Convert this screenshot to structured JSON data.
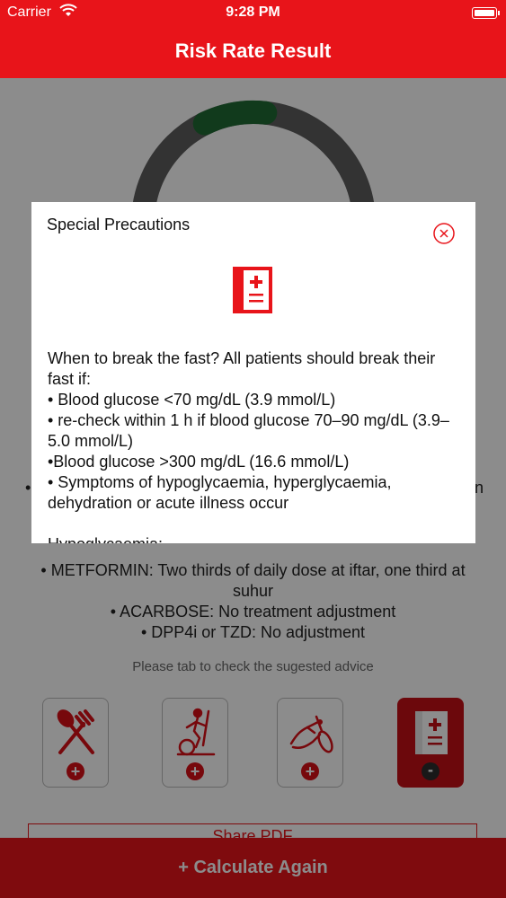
{
  "status_bar": {
    "carrier": "Carrier",
    "time": "9:28 PM"
  },
  "header": {
    "title": "Risk Rate Result"
  },
  "gauge": {
    "level": 0.3,
    "track_color": "#5e5e5e",
    "fill_color": "#1f6b33"
  },
  "content": {
    "bullet_fragment_left": "•",
    "bullet_fragment_right": "n",
    "treatment_lines": [
      "• METFORMIN: Two thirds of daily dose at iftar, one third at",
      "suhur",
      "• ACARBOSE: No treatment adjustment",
      "• DPP4i or TZD: No adjustment"
    ],
    "hint": "Please tab to check the sugested advice"
  },
  "advice_buttons": [
    {
      "name": "diet",
      "icon": "fork-spoon-icon",
      "badge": "+"
    },
    {
      "name": "exercise",
      "icon": "elliptical-trainer-icon",
      "badge": "+"
    },
    {
      "name": "glucose-test",
      "icon": "finger-prick-icon",
      "badge": "+"
    },
    {
      "name": "precautions",
      "icon": "medical-document-icon",
      "badge": "-"
    }
  ],
  "pdf_button": {
    "label": "Share PDF"
  },
  "calculate_button": {
    "label": "+ Calculate Again"
  },
  "modal": {
    "title": "Special Precautions",
    "lines": [
      "When to break the fast? All patients should break their fast if:",
      "• Blood glucose <70 mg/dL (3.9 mmol/L)",
      "• re-check within 1 h if blood glucose 70–90 mg/dL (3.9–5.0 mmol/L)",
      "•Blood glucose >300 mg/dL (16.6 mmol/L)",
      "• Symptoms of hypoglycaemia, hyperglycaemia, dehydration or acute illness occur"
    ],
    "section_heading": "Hypoglycaemia:"
  },
  "colors": {
    "brand_red": "#e8141a",
    "dark_red": "#c51017",
    "overlay": "rgba(0,0,0,0.45)"
  }
}
